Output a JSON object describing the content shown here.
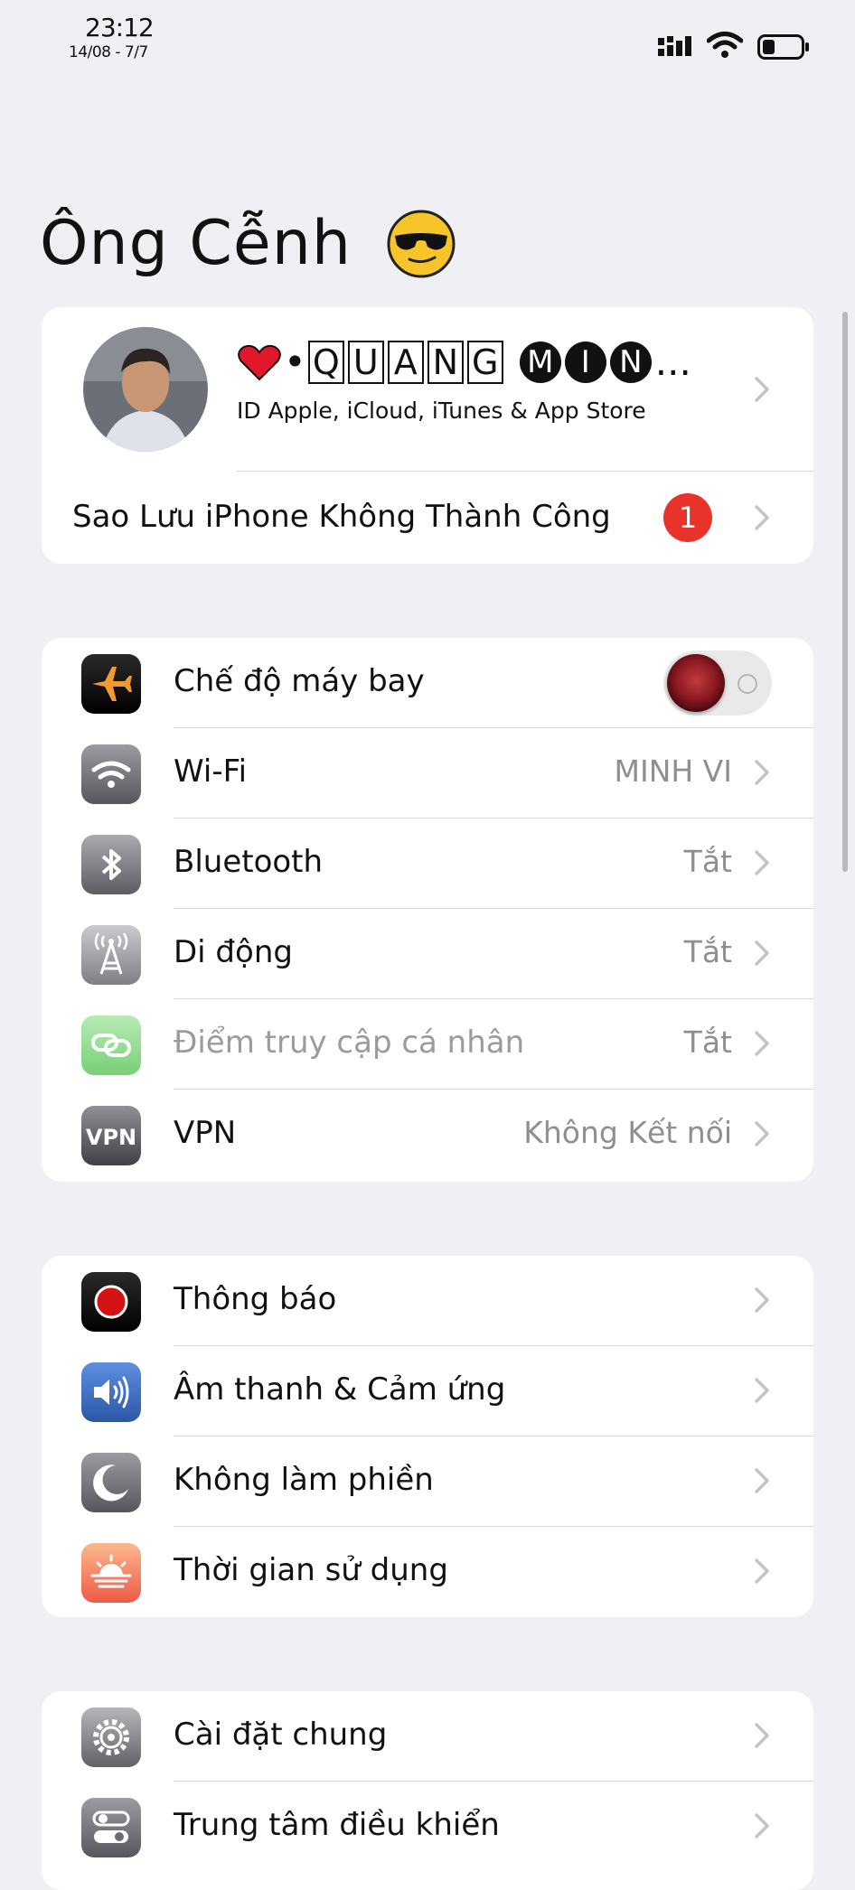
{
  "status_bar": {
    "time": "23:12",
    "date": "14/08 - 7/7"
  },
  "page_title": "Ông Cễnh",
  "profile": {
    "name_prefix": "•",
    "name_boxed": [
      "Q",
      "U",
      "A",
      "N",
      "G"
    ],
    "name_circled": [
      "M",
      "I",
      "N"
    ],
    "name_suffix": "...",
    "subtitle": "ID Apple, iCloud, iTunes & App Store",
    "backup_label": "Sao Lưu iPhone Không Thành Công",
    "backup_badge": "1"
  },
  "network": [
    {
      "label": "Chế độ máy bay",
      "value": "",
      "icon": "airplane-icon",
      "icon_color": "#f29a2e"
    },
    {
      "label": "Wi-Fi",
      "value": "MINH VI",
      "icon": "wifi-icon"
    },
    {
      "label": "Bluetooth",
      "value": "Tắt",
      "icon": "bluetooth-icon"
    },
    {
      "label": "Di động",
      "value": "Tắt",
      "icon": "cellular-antenna-icon"
    },
    {
      "label": "Điểm truy cập cá nhân",
      "value": "Tắt",
      "icon": "hotspot-icon",
      "icon_color": "#6cd66a"
    },
    {
      "label": "VPN",
      "value": "Không Kết nối",
      "icon": "vpn-icon"
    }
  ],
  "notify": [
    {
      "label": "Thông báo",
      "icon": "notifications-icon",
      "icon_color": "#d41414"
    },
    {
      "label": "Âm thanh & Cảm ứng",
      "icon": "sound-icon",
      "icon_color": "#3c6fc8"
    },
    {
      "label": "Không làm phiền",
      "icon": "moon-icon"
    },
    {
      "label": "Thời gian sử dụng",
      "icon": "screen-time-icon",
      "icon_color": "#f47a50"
    }
  ],
  "general": [
    {
      "label": "Cài đặt chung",
      "icon": "gear-icon"
    },
    {
      "label": "Trung tâm điều khiển",
      "icon": "control-center-icon"
    }
  ]
}
